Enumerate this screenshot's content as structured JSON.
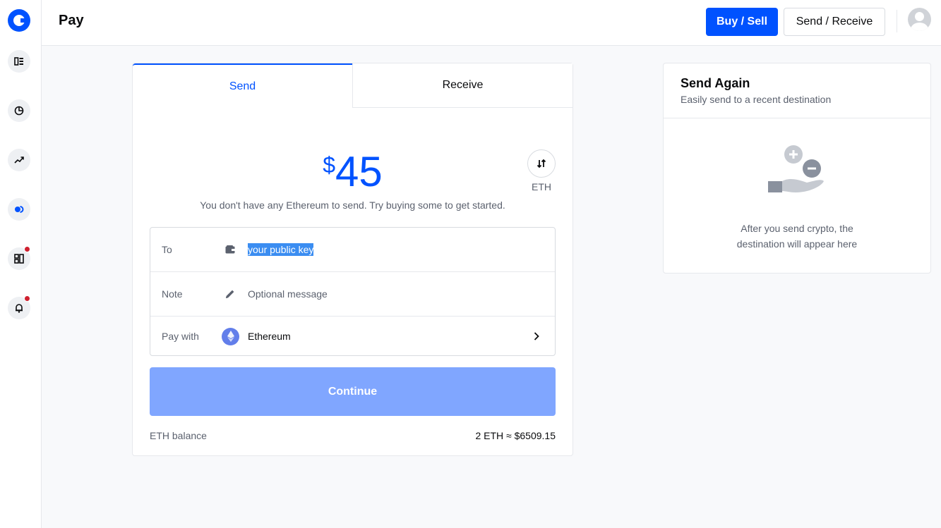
{
  "sidebar": {
    "logo": "coinbase-logo",
    "items": [
      {
        "name": "home",
        "icon": "dashboard-icon",
        "notification": false
      },
      {
        "name": "portfolio",
        "icon": "pie-chart-icon",
        "notification": false
      },
      {
        "name": "trade",
        "icon": "trending-up-icon",
        "notification": false
      },
      {
        "name": "pay",
        "icon": "pay-icon",
        "notification": false
      },
      {
        "name": "apps",
        "icon": "grid-icon",
        "notification": true
      },
      {
        "name": "notifications",
        "icon": "bell-icon",
        "notification": true
      }
    ]
  },
  "header": {
    "title": "Pay",
    "buy_sell_label": "Buy / Sell",
    "send_receive_label": "Send / Receive"
  },
  "send_card": {
    "tabs": [
      {
        "label": "Send",
        "active": true
      },
      {
        "label": "Receive",
        "active": false
      }
    ],
    "currency_symbol": "$",
    "amount": "45",
    "swap_currency": "ETH",
    "hint": "You don't have any Ethereum to send. Try buying some to get started.",
    "to_label": "To",
    "to_value": "your public key",
    "note_label": "Note",
    "note_placeholder": "Optional message",
    "pay_with_label": "Pay with",
    "pay_with_value": "Ethereum",
    "continue_label": "Continue",
    "balance_label": "ETH balance",
    "balance_value": "2 ETH ≈ $6509.15"
  },
  "send_again": {
    "title": "Send Again",
    "subtitle": "Easily send to a recent destination",
    "empty_line1": "After you send crypto, the",
    "empty_line2": "destination will appear here"
  },
  "colors": {
    "brand": "#0052ff",
    "continue_disabled": "#80a6ff",
    "selection": "#3b8df1",
    "notification": "#cf202f",
    "ethereum": "#627eea"
  }
}
